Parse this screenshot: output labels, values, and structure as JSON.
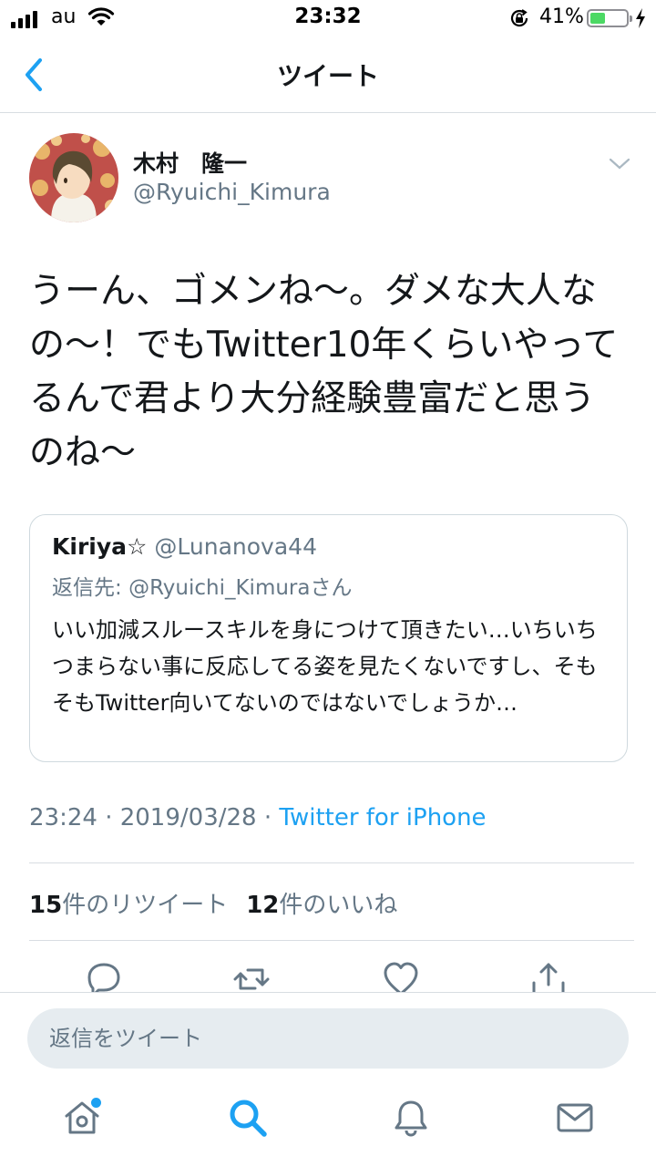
{
  "status_bar": {
    "carrier": "au",
    "time": "23:32",
    "battery": "41%"
  },
  "nav": {
    "title": "ツイート"
  },
  "tweet": {
    "author_name": "木村　隆一",
    "author_handle": "@Ryuichi_Kimura",
    "text": "うーん、ゴメンね〜。ダメな大人なの〜！でもTwitter10年くらいやってるんで君より大分経験豊富だと思うのね〜",
    "timestamp": "23:24 · 2019/03/28 · ",
    "client": "Twitter for iPhone",
    "retweet_count": "15",
    "retweet_label": "件のリツイート",
    "like_count": "12",
    "like_label": "件のいいね"
  },
  "quote": {
    "name": "Kiriya☆",
    "handle": "@Lunanova44",
    "reply_prefix": "返信先: ",
    "reply_to": "@Ryuichi_Kimura",
    "reply_suffix": "さん",
    "text": "いい加減スルースキルを身につけて頂きたい…いちいちつまらない事に反応してる姿を見たくないですし、そもそもTwitter向いてないのではないでしょうか…"
  },
  "reply_bar": {
    "placeholder": "返信をツイート"
  },
  "colors": {
    "accent": "#1da1f2",
    "secondary_text": "#657786",
    "primary_text": "#14171a"
  }
}
